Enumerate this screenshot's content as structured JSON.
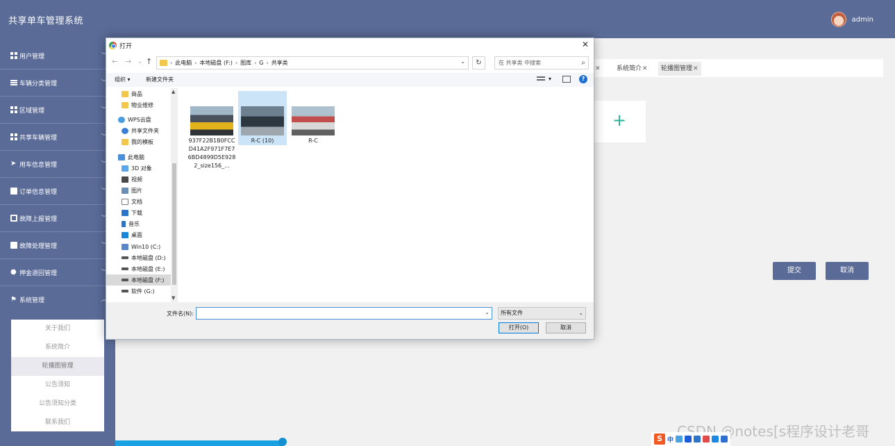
{
  "app": {
    "title": "共享单车管理系统",
    "user": "admin"
  },
  "sidebar": {
    "items": [
      {
        "label": "用户管理",
        "icon": "grid-icon"
      },
      {
        "label": "车辆分类管理",
        "icon": "list-icon"
      },
      {
        "label": "区域管理",
        "icon": "grid-icon"
      },
      {
        "label": "共享车辆管理",
        "icon": "grid-icon"
      },
      {
        "label": "用车信息管理",
        "icon": "send-icon"
      },
      {
        "label": "订单信息管理",
        "icon": "checkbox-icon"
      },
      {
        "label": "故障上报管理",
        "icon": "image-icon"
      },
      {
        "label": "故障处理管理",
        "icon": "monitor-icon"
      },
      {
        "label": "押金退回管理",
        "icon": "user-icon"
      },
      {
        "label": "系统管理",
        "icon": "flag-icon"
      }
    ],
    "submenu": [
      "关于我们",
      "系统简介",
      "轮播图管理",
      "公告须知",
      "公告须知分类",
      "联系我们"
    ]
  },
  "tabs": [
    {
      "label": "系统简介"
    },
    {
      "label": "轮播图管理"
    }
  ],
  "form": {
    "submit": "提交",
    "cancel": "取消"
  },
  "watermark": "CSDN @notes[s程序设计老哥",
  "ime": {
    "label": "中"
  },
  "dialog": {
    "title": "打开",
    "close": "✕",
    "breadcrumb": [
      "此电脑",
      "本地磁盘 (F:)",
      "图库",
      "G",
      "共享类"
    ],
    "search_placeholder": "在 共享类 中搜索",
    "toolbar": {
      "organize": "组织 ▾",
      "new_folder": "新建文件夹"
    },
    "nav_items": [
      {
        "label": "商品",
        "icon": "folder-icon"
      },
      {
        "label": "物业维修",
        "icon": "folder-icon"
      },
      {
        "label": "WPS云盘",
        "icon": "cloud-icon"
      },
      {
        "label": "共享文件夹",
        "icon": "share-icon"
      },
      {
        "label": "我的模板",
        "icon": "folder-icon"
      },
      {
        "label": "此电脑",
        "icon": "computer-icon"
      },
      {
        "label": "3D 对象",
        "icon": "cube-icon"
      },
      {
        "label": "视频",
        "icon": "video-icon"
      },
      {
        "label": "图片",
        "icon": "picture-icon"
      },
      {
        "label": "文档",
        "icon": "document-icon"
      },
      {
        "label": "下载",
        "icon": "download-icon"
      },
      {
        "label": "音乐",
        "icon": "music-icon"
      },
      {
        "label": "桌面",
        "icon": "desktop-icon"
      },
      {
        "label": "Win10 (C:)",
        "icon": "drive-icon"
      },
      {
        "label": "本地磁盘 (D:)",
        "icon": "drive-icon"
      },
      {
        "label": "本地磁盘 (E:)",
        "icon": "drive-icon"
      },
      {
        "label": "本地磁盘 (F:)",
        "icon": "drive-icon"
      },
      {
        "label": "软件 (G:)",
        "icon": "drive-icon"
      }
    ],
    "files": [
      {
        "name": "937F22B1B0FCCD41A2F971F7E76BD4899D5E9282_size156_...",
        "selected": false
      },
      {
        "name": "R-C (10)",
        "selected": true
      },
      {
        "name": "R-C",
        "selected": false
      }
    ],
    "filename_label": "文件名(N):",
    "filename_value": "",
    "filter": "所有文件",
    "open_button": "打开(O)",
    "cancel_button": "取消"
  }
}
